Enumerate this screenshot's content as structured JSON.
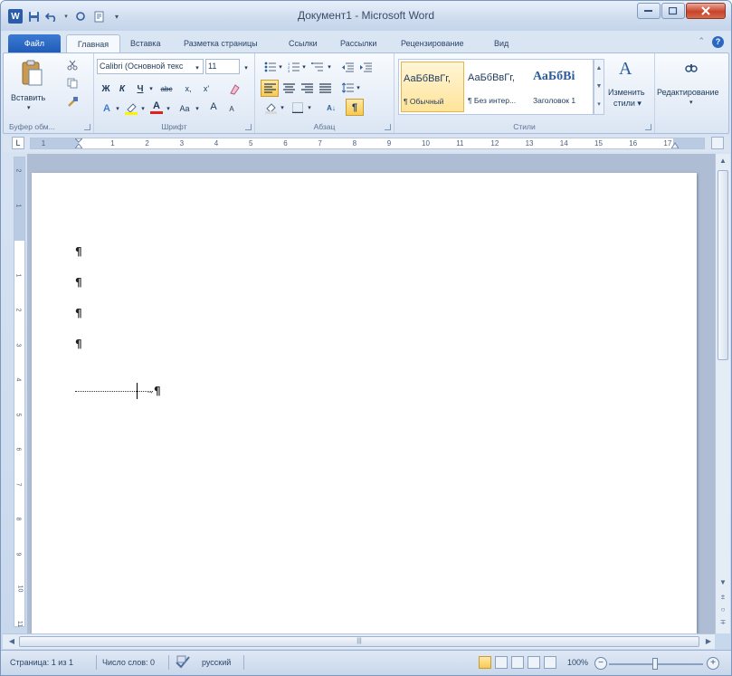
{
  "window": {
    "title": "Документ1 - Microsoft Word"
  },
  "qat": {
    "app_icon": "W"
  },
  "tabs": [
    "Файл",
    "Главная",
    "Вставка",
    "Разметка страницы",
    "Ссылки",
    "Рассылки",
    "Рецензирование",
    "Вид"
  ],
  "ribbon": {
    "clipboard": {
      "paste_label": "Вставить",
      "group_label": "Буфер обм..."
    },
    "font": {
      "font_name": "Calibri (Основной текс",
      "font_size": "11",
      "bold": "Ж",
      "italic": "К",
      "underline": "Ч",
      "strike": "abc",
      "subscript": "x,",
      "superscript": "x'",
      "change_case": "Aa",
      "grow": "A",
      "shrink": "A",
      "font_color": "A",
      "group_label": "Шрифт"
    },
    "paragraph": {
      "group_label": "Абзац",
      "show_marks": "¶",
      "sort": "А↓"
    },
    "styles": {
      "items": [
        {
          "sample": "АаБбВвГг,",
          "name": "¶ Обычный"
        },
        {
          "sample": "АаБбВвГг,",
          "name": "¶ Без интер..."
        },
        {
          "sample": "АаБбВі",
          "name": "Заголовок 1"
        }
      ],
      "change_styles_line1": "Изменить",
      "change_styles_line2": "стили ▾",
      "group_label": "Стили"
    },
    "editing": {
      "label": "Редактирование"
    }
  },
  "ruler": {
    "labels": [
      "1",
      "1",
      "2",
      "3",
      "4",
      "5",
      "6",
      "7",
      "8",
      "9",
      "10",
      "11",
      "12",
      "13",
      "14",
      "15",
      "16",
      "17"
    ],
    "vlabels": [
      "2",
      "1",
      "1",
      "2",
      "3",
      "4",
      "5",
      "6",
      "7",
      "8",
      "9",
      "10",
      "11"
    ]
  },
  "document": {
    "paragraph_mark": "¶"
  },
  "status": {
    "page": "Страница: 1 из 1",
    "words": "Число слов: 0",
    "language": "русский",
    "zoom": "100%"
  },
  "colors": {
    "file_tab": "#2a67c4",
    "highlight_style": "#ffe49a",
    "close_button": "#c9432a"
  }
}
